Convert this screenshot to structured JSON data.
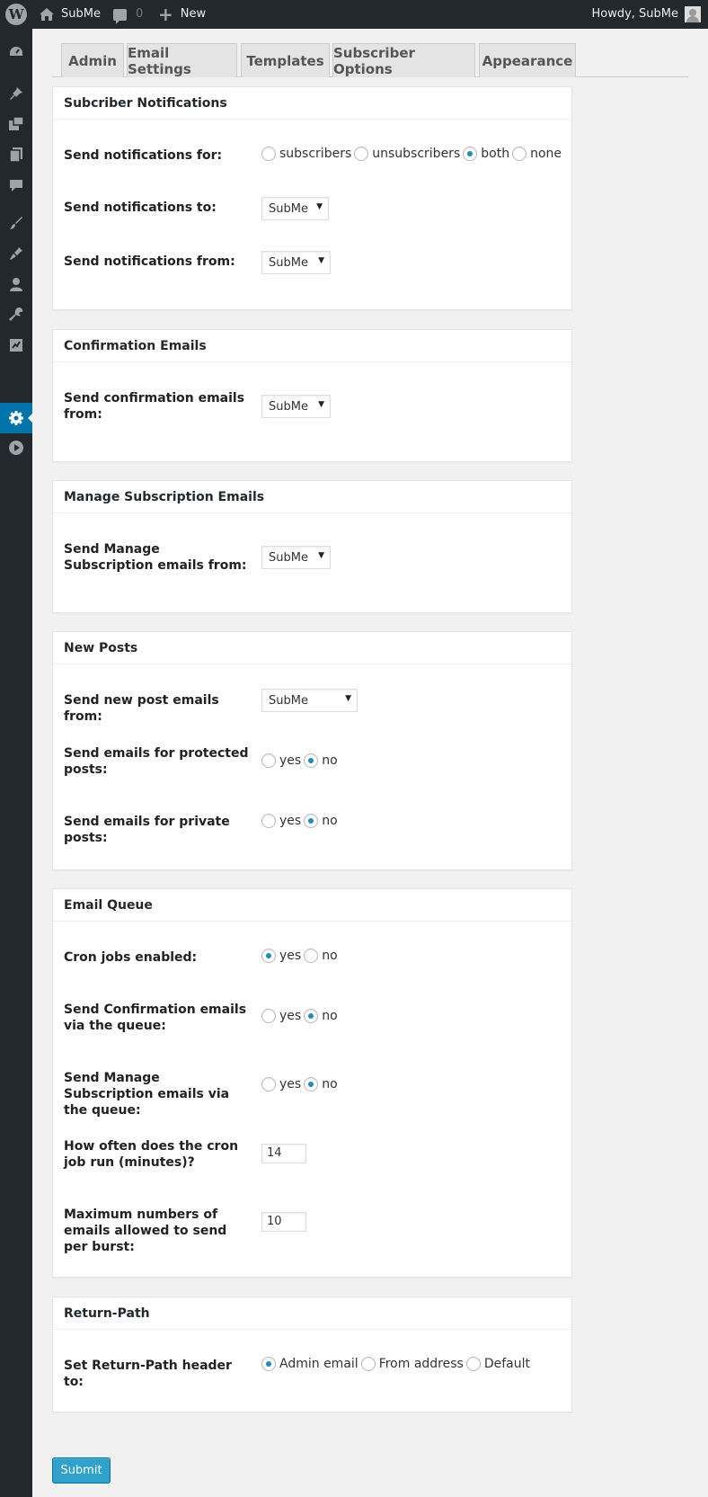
{
  "admin_bar": {
    "site_name": "SubMe",
    "comment_count": "0",
    "new_label": "New",
    "howdy": "Howdy, SubMe"
  },
  "side_menu": {
    "icons": [
      "dashboard-icon",
      "pin-icon",
      "media-icon",
      "pages-icon",
      "comments-icon",
      "appearance-icon",
      "plugins-icon",
      "users-icon",
      "tools-icon",
      "import-icon",
      "settings-icon",
      "play-icon"
    ],
    "current": "settings-icon"
  },
  "tabs": [
    "Admin",
    "Email Settings",
    "Templates",
    "Subscriber Options",
    "Appearance"
  ],
  "sections": {
    "notifications": {
      "title": "Subcriber Notifications",
      "send_for_label": "Send notifications for:",
      "send_for_options": [
        "subscribers",
        "unsubscribers",
        "both",
        "none"
      ],
      "send_for_selected": "both",
      "send_to_label": "Send notifications to:",
      "send_to_value": "SubMe",
      "send_from_label": "Send notifications from:",
      "send_from_value": "SubMe"
    },
    "confirmation": {
      "title": "Confirmation Emails",
      "from_label": "Send confirmation emails from:",
      "from_value": "SubMe"
    },
    "manage": {
      "title": "Manage Subscription Emails",
      "from_label": "Send Manage Subscription emails from:",
      "from_value": "SubMe"
    },
    "new_posts": {
      "title": "New Posts",
      "from_label": "Send new post emails from:",
      "from_value": "SubMe",
      "protected_label": "Send emails for protected posts:",
      "protected_selected": "no",
      "private_label": "Send emails for private posts:",
      "private_selected": "no",
      "yes": "yes",
      "no": "no"
    },
    "queue": {
      "title": "Email Queue",
      "cron_label": "Cron jobs enabled:",
      "cron_selected": "yes",
      "confirm_label": "Send Confirmation emails via the queue:",
      "confirm_selected": "no",
      "manage_label": "Send Manage Subscription emails via the queue:",
      "manage_selected": "no",
      "interval_label": "How often does the cron job run (minutes)?",
      "interval_value": "14",
      "burst_label": "Maximum numbers of emails allowed to send per burst:",
      "burst_value": "10",
      "yes": "yes",
      "no": "no"
    },
    "return_path": {
      "title": "Return-Path",
      "label": "Set Return-Path header to:",
      "options": [
        "Admin email",
        "From address",
        "Default"
      ],
      "selected": "Admin email"
    }
  },
  "submit_label": "Submit",
  "colors": {
    "accent": "#0073aa",
    "button": "#2ea2cc",
    "bar": "#23282d"
  }
}
